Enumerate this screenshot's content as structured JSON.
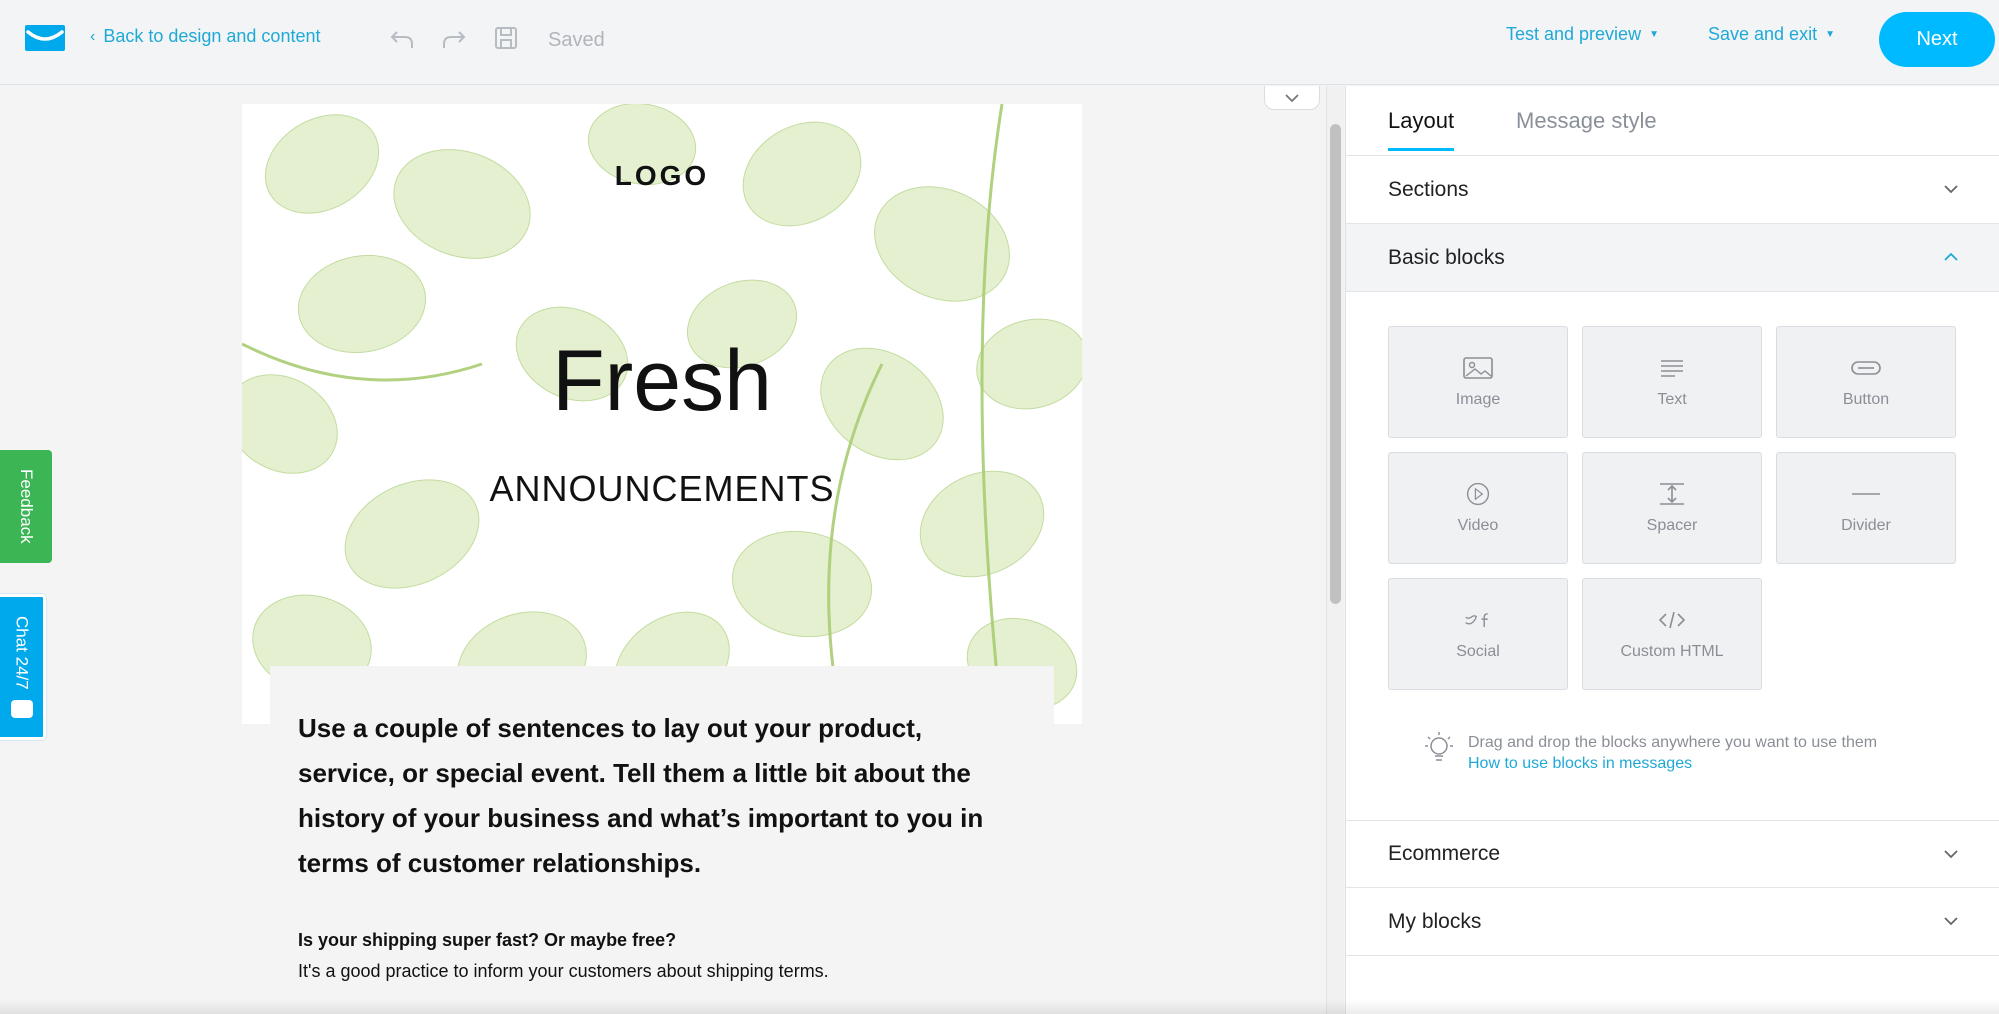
{
  "topbar": {
    "back_label": "Back to design and content",
    "saved_label": "Saved",
    "test_preview_label": "Test and preview",
    "save_exit_label": "Save and exit",
    "next_label": "Next"
  },
  "canvas": {
    "hero_logo": "LOGO",
    "hero_title": "Fresh",
    "hero_subtitle": "ANNOUNCEMENTS",
    "lead_text": "Use a couple of sentences to lay out your product, service, or special event. Tell them a little bit about the history of your business and what’s important to you in terms of customer relationships.",
    "question": "Is your shipping super fast? Or maybe free?",
    "question_body": "It's a good practice to inform your customers about shipping terms."
  },
  "side_tabs": {
    "feedback": "Feedback",
    "chat": "Chat 24/7"
  },
  "panel": {
    "tabs": [
      "Layout",
      "Message style"
    ],
    "sections_label": "Sections",
    "basic_blocks_label": "Basic blocks",
    "blocks": {
      "image": "Image",
      "text": "Text",
      "button": "Button",
      "video": "Video",
      "spacer": "Spacer",
      "divider": "Divider",
      "social": "Social",
      "custom_html": "Custom HTML"
    },
    "hint_text": "Drag and drop the blocks anywhere you want to use them",
    "hint_link": "How to use blocks in messages",
    "ecommerce_label": "Ecommerce",
    "my_blocks_label": "My blocks"
  },
  "colors": {
    "accent": "#00baff",
    "link": "#1fa9d6",
    "feedback_green": "#3cb554",
    "chat_blue": "#00a9ec"
  }
}
